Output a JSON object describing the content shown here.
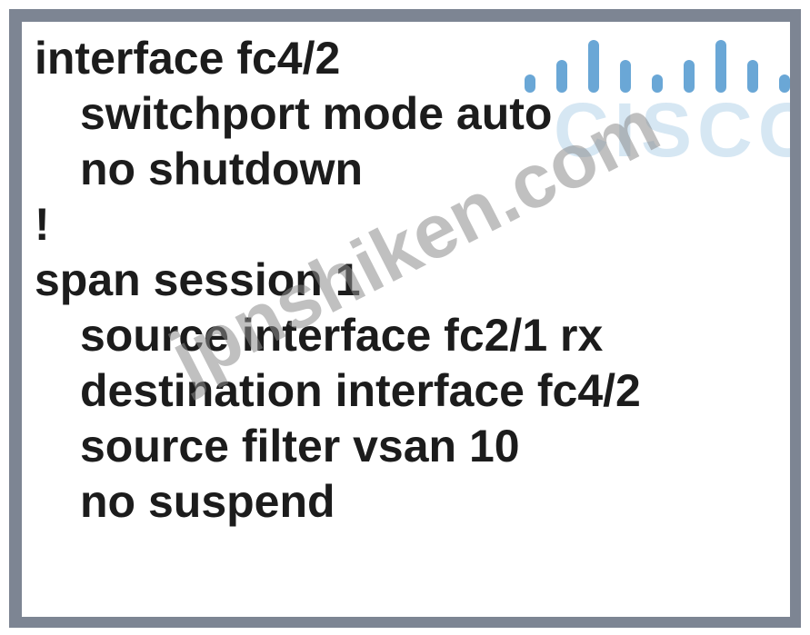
{
  "code_lines": [
    {
      "text": "interface fc4/2",
      "indent": false
    },
    {
      "text": "switchport mode auto",
      "indent": true
    },
    {
      "text": "no shutdown",
      "indent": true
    },
    {
      "text": "!",
      "indent": false
    },
    {
      "text": "span session 1",
      "indent": false
    },
    {
      "text": "source interface fc2/1 rx",
      "indent": true
    },
    {
      "text": "destination interface fc4/2",
      "indent": true
    },
    {
      "text": "source filter vsan 10",
      "indent": true
    },
    {
      "text": "no suspend",
      "indent": true
    }
  ],
  "logo": {
    "word": "CISCO",
    "bar_color": "#6aa7d6",
    "word_color": "#d6e7f3"
  },
  "watermark": {
    "text": "jpnshiken.com",
    "color": "#8c8c8c"
  },
  "colors": {
    "frame": "#7d8593",
    "panel": "#ffffff",
    "text": "#1c1c1c"
  }
}
